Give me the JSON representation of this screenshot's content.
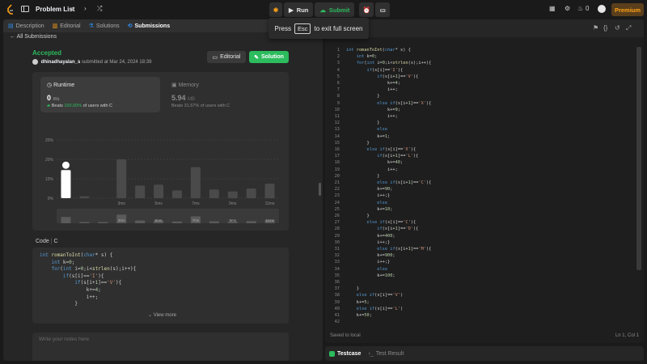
{
  "topbar": {
    "problem_list": "Problem List",
    "run_label": "Run",
    "submit_label": "Submit",
    "streak_count": "0",
    "premium_label": "Premium"
  },
  "toast": {
    "press": "Press",
    "key": "Esc",
    "suffix": "to exit full screen"
  },
  "left": {
    "tabs": [
      {
        "label": "Description"
      },
      {
        "label": "Editorial"
      },
      {
        "label": "Solutions"
      },
      {
        "label": "Submissions"
      }
    ],
    "back_label": "All Submissions",
    "status": "Accepted",
    "username": "dhinadhayalan_s",
    "submitted_text": "submitted at Mar 24, 2024 18:39",
    "editorial_button": "Editorial",
    "solution_button": "Solution",
    "runtime": {
      "title": "Runtime",
      "value": "0",
      "unit": "ms",
      "beats_prefix": "Beats",
      "beats_pct": "100.00%",
      "beats_suffix": "of users with C"
    },
    "memory": {
      "title": "Memory",
      "value": "5.94",
      "unit": "MB",
      "beats_text": "Beats 31.67% of users with C"
    },
    "code_label": "Code",
    "code_lang": "C",
    "code_lines": [
      "int romanToInt(char* s) {",
      "    int k=0;",
      "    for(int i=0;i<strlen(s);i++){",
      "        if(s[i]=='I'){",
      "            if(s[i+1]=='V'){",
      "                k+=4;",
      "                i++;",
      "            }"
    ],
    "view_more": "View more",
    "notes_placeholder": "Write your notes here"
  },
  "chart_data": {
    "type": "bar",
    "yticks": [
      "20%",
      "20%",
      "10%",
      "0%"
    ],
    "xticks": [
      "3ms",
      "5ms",
      "7ms",
      "9ms",
      "11ms"
    ],
    "categories": [
      "0ms",
      "1ms",
      "2ms",
      "3ms",
      "4ms",
      "5ms",
      "6ms",
      "7ms",
      "8ms",
      "9ms",
      "10ms",
      "11ms"
    ],
    "values": [
      14.5,
      1,
      0,
      20,
      6.5,
      7,
      4,
      16,
      4.5,
      3.5,
      5,
      7.5
    ],
    "highlight_index": 0,
    "ylim": [
      0,
      30
    ],
    "grid": true
  },
  "editor": {
    "lang": "C",
    "saved": "Saved to local",
    "cursor": "Ln 1, Col 1",
    "line_numbers": [
      "1",
      "2",
      "3",
      "4",
      "5",
      "6",
      "7",
      "8",
      "9",
      "10",
      "11",
      "12",
      "13",
      "14",
      "15",
      "16",
      "17",
      "18",
      "19",
      "20",
      "21",
      "22",
      "23",
      "24",
      "25",
      "26",
      "27",
      "28",
      "29",
      "30",
      "31",
      "32",
      "33",
      "34",
      "35",
      "36",
      "37",
      "38",
      "39",
      "40",
      "41",
      "42"
    ],
    "lines": [
      "int romanToInt(char* s) {",
      "    int k=0;",
      "    for(int i=0;i<strlen(s);i++){",
      "        if(s[i]=='I'){",
      "            if(s[i+1]=='V'){",
      "                k+=4;",
      "                i++;",
      "            }",
      "            else if(s[i+1]=='X'){",
      "                k+=9;",
      "                i++;",
      "            }",
      "            else",
      "            k+=1;",
      "        }",
      "        else if(s[i]=='X'){",
      "            if(s[i+1]=='L'){",
      "                k+=40;",
      "                i++;",
      "            }",
      "            else if(s[i+1]=='C'){",
      "            k+=90;",
      "            i++;}",
      "            else",
      "            k+=10;",
      "        }",
      "        else if(s[i]=='C'){",
      "            if(s[i+1]=='D'){",
      "            k+=400;",
      "            i++;}",
      "            else if(s[i+1]=='M'){",
      "            k+=900;",
      "            i++;}",
      "            else",
      "            k+=100;",
      "",
      "    }",
      "    else if(s[i]=='V')",
      "    k+=5;",
      "    else if(s[i]=='L')",
      "    k+=50;",
      ""
    ]
  },
  "bottom": {
    "testcase": "Testcase",
    "test_result": "Test Result"
  },
  "colors": {
    "accent_green": "#2cbb5d",
    "premium_orange": "#ffa116",
    "bar_default": "#4a4a4a",
    "bar_highlight": "#ffffff"
  }
}
